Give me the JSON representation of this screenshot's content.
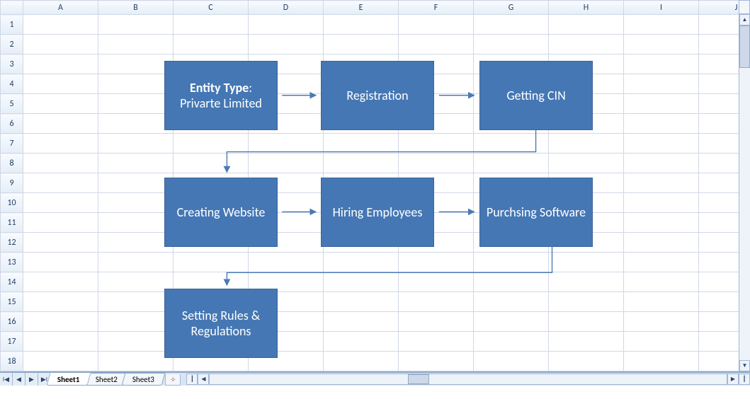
{
  "columns": [
    "A",
    "B",
    "C",
    "D",
    "E",
    "F",
    "G",
    "H",
    "I",
    "J"
  ],
  "row_count": 18,
  "shapes": {
    "entity_type_label": "Entity Type",
    "entity_type_value": "Privarte Limited",
    "registration": "Registration",
    "getting_cin": "Getting CIN",
    "creating_website": "Creating Website",
    "hiring_employees": "Hiring Employees",
    "purchasing_software": "Purchsing Software",
    "setting_rules": "Setting Rules & Regulations"
  },
  "tabs": {
    "sheet1": "Sheet1",
    "sheet2": "Sheet2",
    "sheet3": "Sheet3"
  },
  "colors": {
    "shape_fill": "#4577b4",
    "shape_border": "#3b6399",
    "arrow": "#4a7ab5"
  }
}
